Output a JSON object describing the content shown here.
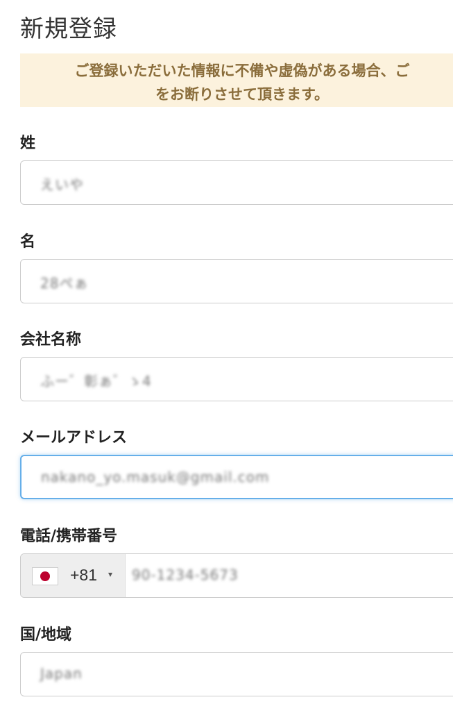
{
  "page": {
    "title": "新規登録"
  },
  "notice": {
    "line1": "ご登録いただいた情報に不備や虚偽がある場合、ご",
    "line2": "をお断りさせて頂きます。"
  },
  "fields": {
    "last_name": {
      "label": "姓",
      "value": "えいや"
    },
    "first_name": {
      "label": "名",
      "value": "28ぺぁ"
    },
    "company": {
      "label": "会社名称",
      "value": "ふー゛彰ぁ゛ゝ4"
    },
    "email": {
      "label": "メールアドレス",
      "value": "nakano_yo.masuk@gmail.com"
    },
    "phone": {
      "label": "電話/携帯番号",
      "country_flag": "japan-flag",
      "dial_code": "+81",
      "caret": "▾",
      "value": "90-1234-5673"
    },
    "region": {
      "label": "国/地域",
      "value": "Japan"
    }
  },
  "colors": {
    "notice_bg": "#fcf2dd",
    "notice_text": "#8a6d3b",
    "focus_border": "#66afe9",
    "flag_red": "#bc002d"
  }
}
